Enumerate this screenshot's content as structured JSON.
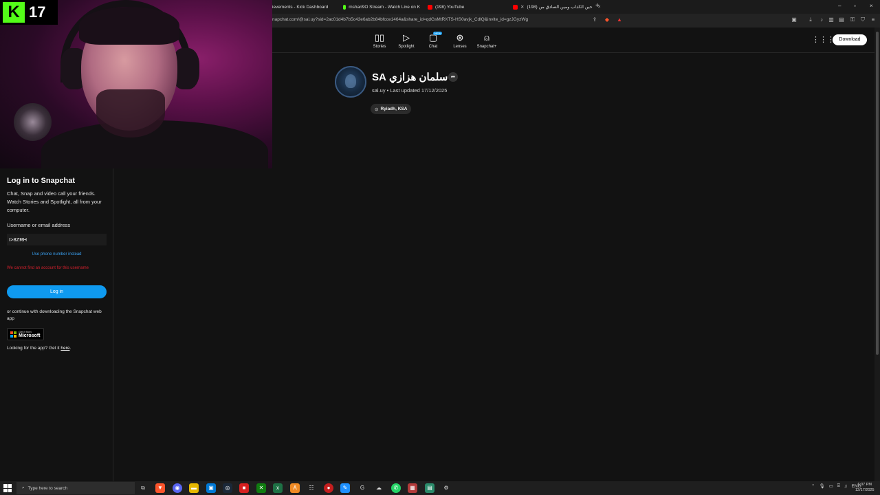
{
  "browser": {
    "tabs": [
      {
        "label": "ievements - Kick Dashboard",
        "color": "#53fc18"
      },
      {
        "label": "mshari9O Stream - Watch Live on K",
        "color": "#53fc18"
      },
      {
        "label": "(198) YouTube",
        "color": "#ff0000"
      },
      {
        "label": "(198) حين الكذاب ومين الصادق من",
        "color": "#ff0000"
      }
    ],
    "new_tab": "+",
    "url": "napchat.com/@sal.uy?sid=2ac01d4b7b5c43e6ab2b84bfcce1464a&share_id=qdGsMtRXTS-HS0avjk_CdlQ&invite_id=gzJGyzWg"
  },
  "snap_nav": {
    "items": [
      {
        "label": "Stories",
        "icon": "stories-icon",
        "glyph": "▯▯"
      },
      {
        "label": "Spotlight",
        "icon": "play-icon",
        "glyph": "▷"
      },
      {
        "label": "Chat",
        "icon": "chat-icon",
        "glyph": "▢"
      },
      {
        "label": "Lenses",
        "icon": "lens-icon",
        "glyph": "⊛"
      },
      {
        "label": "Snapchat+",
        "icon": "ghost-icon",
        "glyph": "⍝"
      }
    ],
    "chat_badge": "NEW",
    "download_label": "Download"
  },
  "profile": {
    "name": "سلمان هزازي SA",
    "handle": "sal.uy",
    "meta_separator": " • ",
    "last_updated": "Last updated 17/12/2025",
    "location": "Ryiadh, KSA"
  },
  "login": {
    "title": "Log in to Snapchat",
    "description": "Chat, Snap and video call your friends. Watch Stories and Spotlight, all from your computer.",
    "username_label": "Username or email address",
    "username_value": "I>8ZRH",
    "phone_link": "Use phone number instead",
    "error": "We cannot find an account for this username",
    "login_button": "Log in",
    "continue_text": "or continue with downloading the Snapchat web app",
    "ms_badge_small": "Get it from",
    "ms_badge_big": "Microsoft",
    "looking_text": "Looking for the app? Get it ",
    "looking_link": "here",
    "looking_end": "."
  },
  "stream": {
    "viewer_count": "17",
    "kick_logo": "K"
  },
  "taskbar": {
    "search_placeholder": "Type here to search",
    "language": "ENG",
    "time": "6:07 PM",
    "date": "12/17/2025"
  },
  "colors": {
    "kick_green": "#53fc18",
    "snap_blue": "#0f9af0",
    "error_red": "#d0202c"
  }
}
